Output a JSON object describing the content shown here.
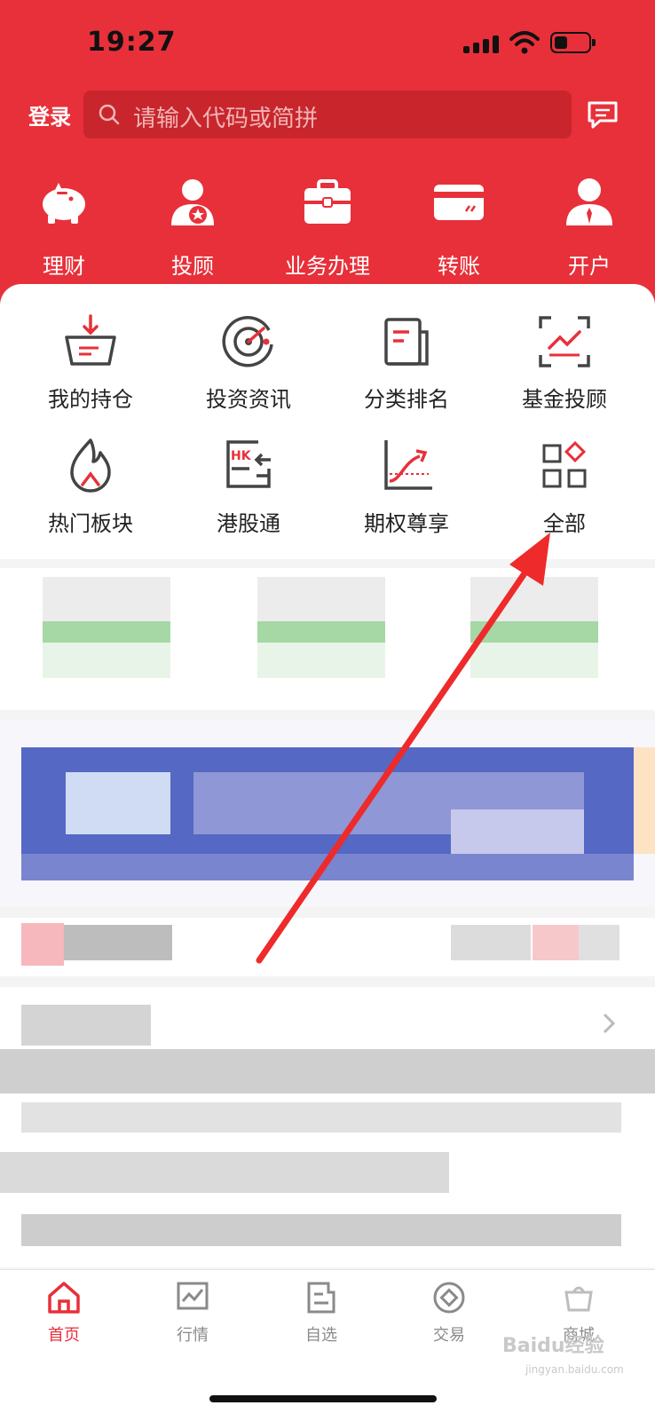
{
  "status": {
    "time": "19:27"
  },
  "header": {
    "login_label": "登录",
    "search_placeholder": "请输入代码或简拼"
  },
  "top_nav": [
    {
      "label": "理财",
      "icon": "piggy-bank-icon"
    },
    {
      "label": "投顾",
      "icon": "advisor-icon"
    },
    {
      "label": "业务办理",
      "icon": "briefcase-icon"
    },
    {
      "label": "转账",
      "icon": "card-icon"
    },
    {
      "label": "开户",
      "icon": "user-icon"
    }
  ],
  "grid": [
    {
      "label": "我的持仓",
      "icon": "holdings-icon"
    },
    {
      "label": "投资资讯",
      "icon": "radar-icon"
    },
    {
      "label": "分类排名",
      "icon": "ranking-icon"
    },
    {
      "label": "基金投顾",
      "icon": "fund-advisor-icon"
    },
    {
      "label": "热门板块",
      "icon": "flame-icon"
    },
    {
      "label": "港股通",
      "icon": "hk-connect-icon"
    },
    {
      "label": "期权尊享",
      "icon": "options-chart-icon"
    },
    {
      "label": "全部",
      "icon": "all-apps-icon"
    }
  ],
  "tabs": [
    {
      "label": "首页",
      "icon": "home-icon",
      "active": true
    },
    {
      "label": "行情",
      "icon": "market-icon",
      "active": false
    },
    {
      "label": "自选",
      "icon": "watchlist-icon",
      "active": false
    },
    {
      "label": "交易",
      "icon": "trade-icon",
      "active": false
    },
    {
      "label": "商城",
      "icon": "mall-icon",
      "active": false
    }
  ],
  "watermark": {
    "text": "Baidu经验",
    "url_text": "jingyan.baidu.com"
  },
  "colors": {
    "brand_red": "#e8303a",
    "annotation_arrow": "#ee2a2a"
  }
}
